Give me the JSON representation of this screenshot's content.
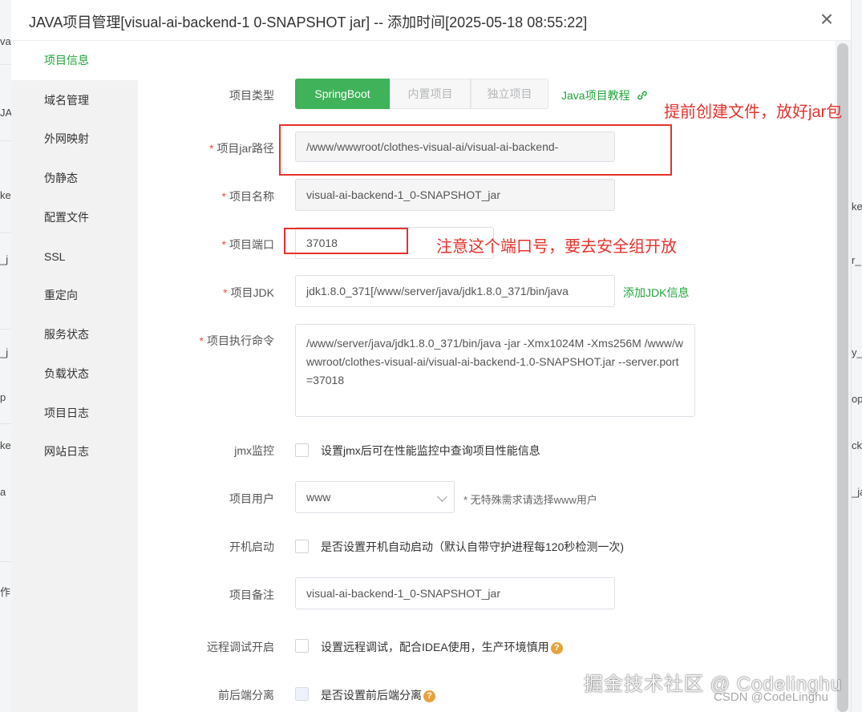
{
  "modal": {
    "title": "JAVA项目管理[visual-ai-backend-1 0-SNAPSHOT jar] -- 添加时间[2025-05-18 08:55:22]",
    "close_symbol": "×"
  },
  "sidebar": {
    "items": [
      {
        "label": "项目信息"
      },
      {
        "label": "域名管理"
      },
      {
        "label": "外网映射"
      },
      {
        "label": "伪静态"
      },
      {
        "label": "配置文件"
      },
      {
        "label": "SSL"
      },
      {
        "label": "重定向"
      },
      {
        "label": "服务状态"
      },
      {
        "label": "负载状态"
      },
      {
        "label": "项目日志"
      },
      {
        "label": "网站日志"
      }
    ]
  },
  "form": {
    "project_type": {
      "label": "项目类型",
      "options": [
        "SpringBoot",
        "内置项目",
        "独立项目"
      ],
      "selected": "SpringBoot",
      "tutorial_link": "Java项目教程",
      "link_icon": "link-icon"
    },
    "jar_path": {
      "label": "项目jar路径",
      "value": "/www/wwwroot/clothes-visual-ai/visual-ai-backend-"
    },
    "project_name": {
      "label": "项目名称",
      "value": "visual-ai-backend-1_0-SNAPSHOT_jar"
    },
    "port": {
      "label": "项目端口",
      "value": "37018"
    },
    "jdk": {
      "label": "项目JDK",
      "value": "jdk1.8.0_371[/www/server/java/jdk1.8.0_371/bin/java",
      "add_link": "添加JDK信息"
    },
    "command": {
      "label": "项目执行命令",
      "value": "/www/server/java/jdk1.8.0_371/bin/java  -jar -Xmx1024M -Xms256M  /www/wwwroot/clothes-visual-ai/visual-ai-backend-1.0-SNAPSHOT.jar --server.port=37018"
    },
    "jmx": {
      "label": "jmx监控",
      "text": "设置jmx后可在性能监控中查询项目性能信息"
    },
    "user": {
      "label": "项目用户",
      "value": "www",
      "hint": "* 无特殊需求请选择www用户"
    },
    "autostart": {
      "label": "开机启动",
      "text": "是否设置开机自动启动（默认自带守护进程每120秒检测一次)"
    },
    "remark": {
      "label": "项目备注",
      "value": "visual-ai-backend-1_0-SNAPSHOT_jar"
    },
    "remote_debug": {
      "label": "远程调试开启",
      "text": "设置远程调试，配合IDEA使用，生产环境慎用"
    },
    "split": {
      "label": "前后端分离",
      "text": "是否设置前后端分离"
    },
    "help_symbol": "?"
  },
  "annotations": {
    "jar_note": "提前创建文件，放好jar包",
    "port_note": "注意这个端口号，要去安全组开放"
  },
  "watermark": {
    "main": "掘金技术社区 @ Codelinghu",
    "sub": "CSDN @CodeLinghu"
  },
  "background": {
    "left_fragments": [
      "va",
      "JA",
      "ke",
      "_j",
      "_j",
      "p",
      "ke",
      "a",
      "作"
    ],
    "right_fragments": [
      "ke",
      "r_",
      "y_",
      "op",
      "cke",
      "_ja"
    ]
  },
  "colors": {
    "accent": "#20a53a",
    "annotation": "#e5322d",
    "required": "#e94e45"
  }
}
